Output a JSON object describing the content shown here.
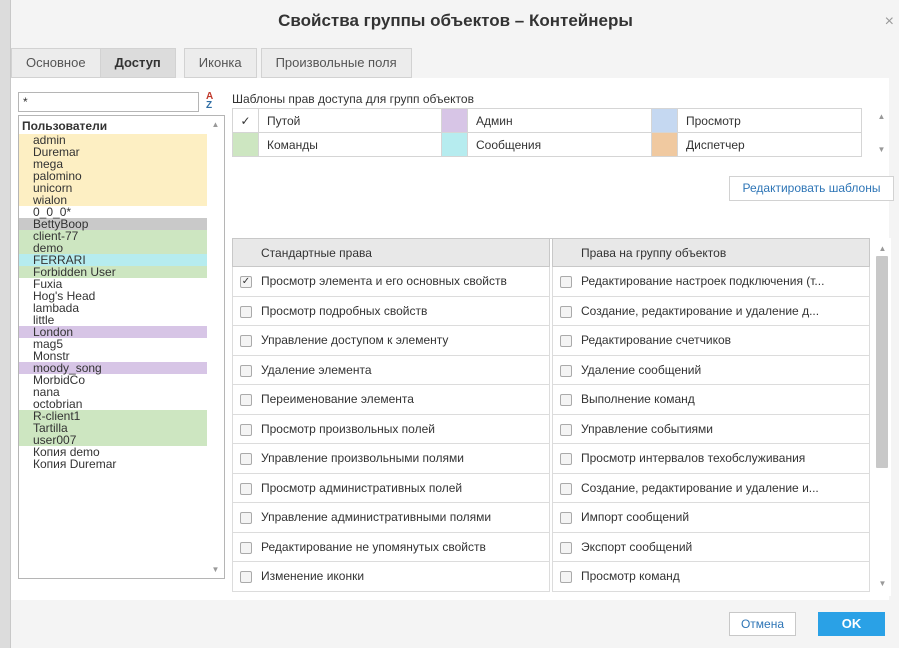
{
  "dialog": {
    "title": "Свойства группы объектов – Контейнеры",
    "close_glyph": "×"
  },
  "tabs": [
    {
      "label": "Основное",
      "active": false
    },
    {
      "label": "Доступ",
      "active": true
    },
    {
      "label": "Иконка",
      "active": false
    },
    {
      "label": "Произвольные поля",
      "active": false
    }
  ],
  "filter": {
    "value": "*"
  },
  "users": {
    "group_label": "Пользователи",
    "items": [
      {
        "name": "admin",
        "color": "#fdefc3"
      },
      {
        "name": "Duremar",
        "color": "#fdefc3"
      },
      {
        "name": "mega",
        "color": "#fdefc3"
      },
      {
        "name": "palomino",
        "color": "#fdefc3"
      },
      {
        "name": "unicorn",
        "color": "#fdefc3"
      },
      {
        "name": "wialon",
        "color": "#fdefc3"
      },
      {
        "name": "0_0_0*",
        "color": "#ffffff"
      },
      {
        "name": "BettyBoop",
        "color": "#c9c9c9"
      },
      {
        "name": "client-77",
        "color": "#cde6c1"
      },
      {
        "name": "demo",
        "color": "#cde6c1"
      },
      {
        "name": "FERRARI",
        "color": "#b6ecef"
      },
      {
        "name": "Forbidden User",
        "color": "#cde6c1"
      },
      {
        "name": "Fuxia",
        "color": "#ffffff"
      },
      {
        "name": "Hog's Head",
        "color": "#ffffff"
      },
      {
        "name": "lambada",
        "color": "#ffffff"
      },
      {
        "name": "little",
        "color": "#ffffff"
      },
      {
        "name": "London",
        "color": "#d7c5e6"
      },
      {
        "name": "mag5",
        "color": "#ffffff"
      },
      {
        "name": "Monstr",
        "color": "#ffffff"
      },
      {
        "name": "moody_song",
        "color": "#d7c5e6"
      },
      {
        "name": "MorbidCo",
        "color": "#ffffff"
      },
      {
        "name": "nana",
        "color": "#ffffff"
      },
      {
        "name": "octobrian",
        "color": "#ffffff"
      },
      {
        "name": "R-client1",
        "color": "#cde6c1"
      },
      {
        "name": "Tartilla",
        "color": "#cde6c1"
      },
      {
        "name": "user007",
        "color": "#cde6c1"
      },
      {
        "name": "Копия demo",
        "color": "#ffffff"
      },
      {
        "name": "Копия Duremar",
        "color": "#ffffff"
      }
    ]
  },
  "templates": {
    "label": "Шаблоны прав доступа для групп объектов",
    "items": [
      {
        "name": "Путой",
        "color": "#ffffff",
        "checked": true
      },
      {
        "name": "Админ",
        "color": "#d7c5e6",
        "checked": false
      },
      {
        "name": "Просмотр",
        "color": "#c5d8f1",
        "checked": false
      },
      {
        "name": "Команды",
        "color": "#cde6c1",
        "checked": false
      },
      {
        "name": "Сообщения",
        "color": "#b6ecef",
        "checked": false
      },
      {
        "name": "Диспетчер",
        "color": "#f0c9a0",
        "checked": false
      }
    ],
    "edit_label": "Редактировать шаблоны"
  },
  "rights": {
    "standard_header": "Стандартные права",
    "group_header": "Права на группу объектов",
    "standard": [
      {
        "label": "Просмотр элемента и его основных свойств",
        "checked": true
      },
      {
        "label": "Просмотр подробных свойств",
        "checked": false
      },
      {
        "label": "Управление доступом к элементу",
        "checked": false
      },
      {
        "label": "Удаление элемента",
        "checked": false
      },
      {
        "label": "Переименование элемента",
        "checked": false
      },
      {
        "label": "Просмотр произвольных полей",
        "checked": false
      },
      {
        "label": "Управление произвольными полями",
        "checked": false
      },
      {
        "label": "Просмотр административных полей",
        "checked": false
      },
      {
        "label": "Управление административными полями",
        "checked": false
      },
      {
        "label": "Редактирование не упомянутых свойств",
        "checked": false
      },
      {
        "label": "Изменение иконки",
        "checked": false
      }
    ],
    "group": [
      {
        "label": "Редактирование настроек подключения (т...",
        "checked": false
      },
      {
        "label": "Создание, редактирование и удаление д...",
        "checked": false
      },
      {
        "label": "Редактирование счетчиков",
        "checked": false
      },
      {
        "label": "Удаление сообщений",
        "checked": false
      },
      {
        "label": "Выполнение команд",
        "checked": false
      },
      {
        "label": "Управление событиями",
        "checked": false
      },
      {
        "label": "Просмотр интервалов техобслуживания",
        "checked": false
      },
      {
        "label": "Создание, редактирование и удаление и...",
        "checked": false
      },
      {
        "label": "Импорт сообщений",
        "checked": false
      },
      {
        "label": "Экспорт сообщений",
        "checked": false
      },
      {
        "label": "Просмотр команд",
        "checked": false
      }
    ]
  },
  "buttons": {
    "cancel": "Отмена",
    "ok": "OK"
  },
  "glyphs": {
    "check": "✓",
    "sort_top": "A",
    "sort_bottom": "Z"
  },
  "colors": {
    "accent": "#2aa1e6",
    "link": "#2e75b6"
  }
}
